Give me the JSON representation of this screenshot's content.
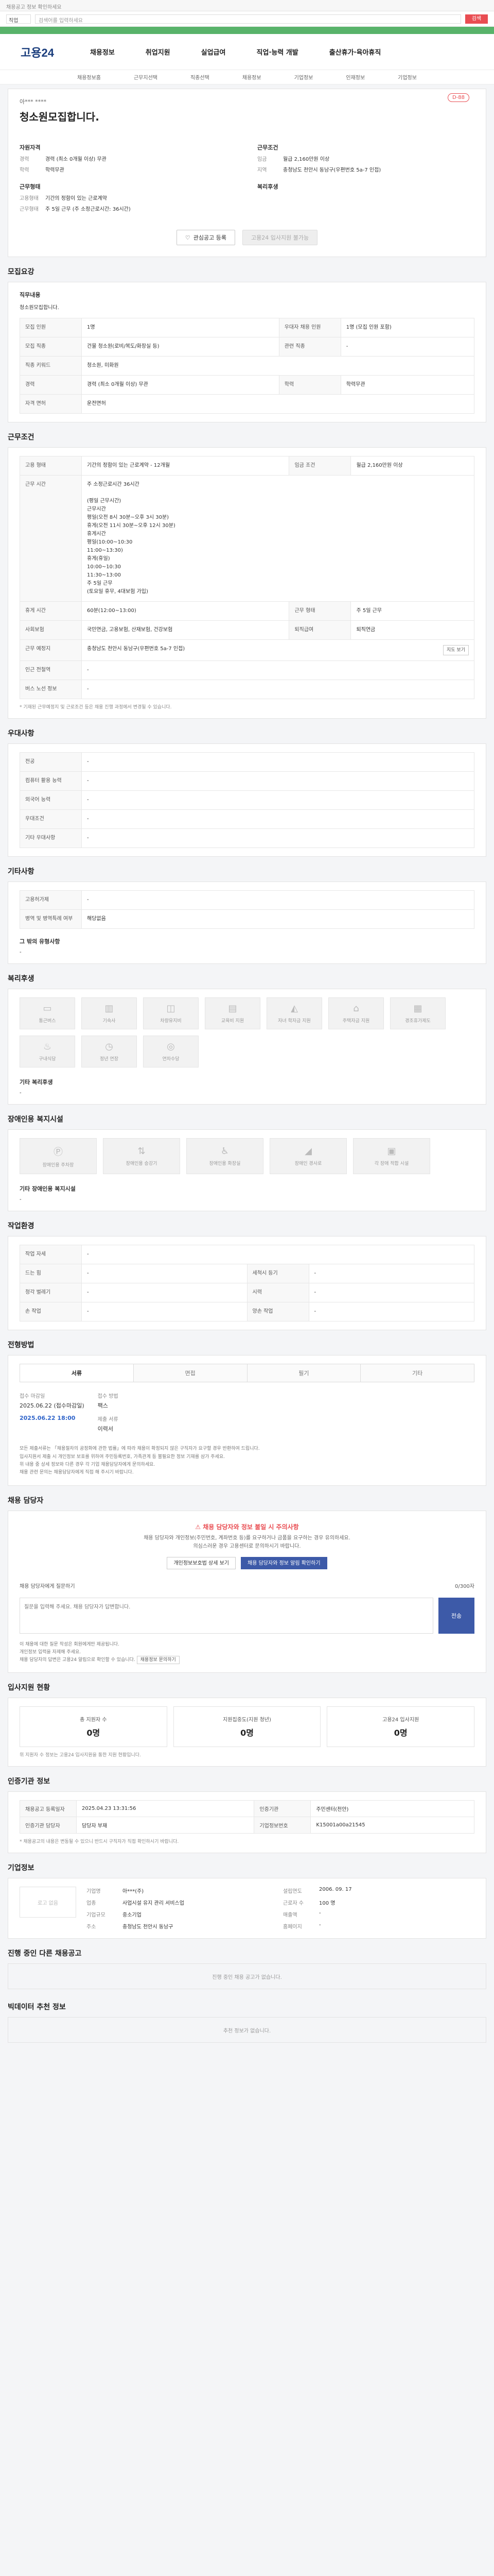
{
  "topnote": "채용공고 정보 확인하세요",
  "search": {
    "select": "직업",
    "placeholder": "검색어를 입력하세요",
    "button": "검색"
  },
  "greenbar": "",
  "header": {
    "logo": "고용24",
    "nav": [
      "채용정보",
      "취업지원",
      "실업급여",
      "직업·능력 개발",
      "출산휴가·육아휴직"
    ],
    "subnav": [
      "채용정보홈",
      "근무지선택",
      "직종선택",
      "채용정보",
      "기업정보",
      "인재정보",
      "기업정보"
    ]
  },
  "job": {
    "company": "아*** ****",
    "title": "청소원모집합니다.",
    "badge": "D-88",
    "left_title": "자원자격",
    "left_rows": [
      {
        "k": "경력",
        "v": "경력 (최소 0개월 이상) 무관"
      },
      {
        "k": "학력",
        "v": "학력무관"
      }
    ],
    "left_title2": "근무형태",
    "left_rows2": [
      {
        "k": "고용형태",
        "v": "기간의 정함이 있는 근로계약"
      },
      {
        "k": "근무형태",
        "v": "주 5일 근무 (주 소정근로시간: 36시간)"
      }
    ],
    "right_title": "근무조건",
    "right_rows": [
      {
        "k": "임금",
        "v": "월급 2,160만원 이상"
      },
      {
        "k": "지역",
        "v": "충청남도 천안시 동남구(우편번호 5a-7 인접)"
      }
    ],
    "right_title2": "복리후생",
    "btn_scrap": "관심공고 등록",
    "btn_apply": "고용24 입사지원 불가능"
  },
  "summary": {
    "title": "모집요강",
    "desc_label": "직무내용",
    "desc": "청소원모집합니다.",
    "rows": [
      [
        "모집 인원",
        "1명",
        "우대자 채용 인원",
        "1명 (모집 인원 포함)"
      ],
      [
        "모집 직종",
        "건물 청소원(로비/복도/화장실 등)",
        "관련 직종",
        "-"
      ],
      [
        "직종 키워드",
        "청소원, 미화원",
        "",
        ""
      ],
      [
        "경력",
        "경력 (최소 0개월 이상) 무관",
        "학력",
        "학력무관"
      ],
      [
        "자격 면허",
        "운전면허",
        "",
        ""
      ]
    ]
  },
  "conditions": {
    "title": "근무조건",
    "rows": [
      [
        "고용 형태",
        "기간의 정함이 있는 근로계약 - 12개월",
        "임금 조건",
        "월급 2,160만원 이상"
      ],
      [
        "근무 시간",
        "주 소정근로시간 36시간\n\n(평일 근무시간)\n근무시간\n평일(오전 8시 30분~오후 3시 30분)\n휴게(오전 11시 30분~오후 12시 30분)\n휴게시간\n평일(10:00~10:30\n       11:00~13:30)\n휴게(휴일)\n10:00~10:30\n11:30~13:00\n주 5일 근무\n(토요일 휴무, 4대보험 가입)",
        "",
        ""
      ],
      [
        "휴게 시간",
        "60분(12:00~13:00)",
        "근무 형태",
        "주 5일 근무"
      ],
      [
        "사회보험",
        "국민연금, 고용보험, 산재보험, 건강보험",
        "퇴직급여",
        "퇴직연금"
      ],
      [
        "근무 예정지",
        "충청남도 천안시 동남구(우편번호 5a-7 인접)",
        "",
        ""
      ],
      [
        "인근 전철역",
        "-",
        "",
        ""
      ],
      [
        "버스 노선 정보",
        "-",
        "",
        ""
      ]
    ],
    "mapbtn": "지도 보기",
    "note": "* 기재된 근무예정지 및 근로조건 등은 채용 진행 과정에서 변경될 수 있습니다."
  },
  "prefs": {
    "title": "우대사항",
    "rows": [
      [
        "전공",
        "-"
      ],
      [
        "컴퓨터 활용 능력",
        "-"
      ],
      [
        "외국어 능력",
        "-"
      ],
      [
        "우대조건",
        "-"
      ],
      [
        "기타 우대사항",
        "-"
      ]
    ]
  },
  "etc": {
    "title": "기타사항",
    "rows": [
      [
        "고용허가제",
        "-"
      ],
      [
        "병역 및 병역특례 여부",
        "해당없음"
      ]
    ],
    "extra_label": "그 밖의 유형사항",
    "extra_val": "-"
  },
  "welfare": {
    "title": "복리후생",
    "items": [
      "통근버스",
      "기숙사",
      "차량유지비",
      "교육비 지원",
      "자녀 학자금 지원",
      "주택자금 지원",
      "경조휴가제도",
      "구내식당",
      "정년 연장",
      "연차수당"
    ],
    "other_label": "기타 복리후생",
    "other_val": "-"
  },
  "disability": {
    "title": "장애인용 복지시설",
    "items": [
      "장애인용 주차장",
      "장애인용 승강기",
      "장애인용 화장실",
      "장애인 경사로",
      "각 장애 적합 시설"
    ],
    "other_label": "기타 장애인용 복지시설",
    "other_val": "-"
  },
  "pref_env": {
    "title": "작업환경",
    "rows": [
      [
        "작업 자세",
        "-",
        "",
        ""
      ],
      [
        "드는 힘",
        "-",
        "세척시 등기",
        "-"
      ],
      [
        "청각 벌레기",
        "-",
        "시력",
        "-"
      ],
      [
        "손 작업",
        "-",
        "양손 작업",
        "-"
      ]
    ]
  },
  "method": {
    "title": "전형방법",
    "tabs": [
      "서류",
      "면접",
      "필기",
      "기타"
    ],
    "deadline_label": "접수 마감일",
    "deadline": "2025.06.22 (접수마감일)",
    "deadline_time": "2025.06.22 18:00",
    "apply_label": "접수 방법",
    "apply": "팩스",
    "docs_label": "제출 서류",
    "docs": "이력서",
    "bullets": [
      "모든 제출서류는 「채용절차의 공정화에 관한 법률」에 따라 채용이 확정되지 않은 구직자가 요구할 경우 반환하여 드립니다.",
      "입사지원서 제출 시 개인정보 보호를 위하여 주민등록번호, 가족관계 등 불필요한 정보 기재를 삼가 주세요.",
      "위 내용 중 상세 정보와 다른 경우 각 기업 채용담당자에게 문의하세요.",
      "채용 관련 문의는 채용담당자에게 직접 해 주시기 바랍니다."
    ]
  },
  "contact": {
    "title": "채용 담당자",
    "warn_title": "채용 담당자와 정보 불일 시 주의사항",
    "warn_desc": "채용 담당자와 개인정보(주민번호, 계좌번호 등)를 요구하거나 금품을 요구하는 경우 유의하세요.\n의심스러운 경우 고용센터로 문의하시기 바랍니다.",
    "btn1": "개인정보보호법 상세 보기",
    "btn2": "채용 담당자와 정보 알림 확인하기",
    "ask_label": "채용 담당자에게 질문하기",
    "ask_note": "0/300자",
    "ask_placeholder": "질문을 입력해 주세요. 채용 담당자가 답변합니다.",
    "ask_btn": "전송",
    "notes": [
      "이 채용에 대한 질문 작성은 회원에게만 제공됩니다.",
      "개인정보 입력을 자제해 주세요.",
      "채용 담당자의 답변은 고용24 알림으로 확인할 수 있습니다."
    ],
    "notes_btn": "채용정보 문의하기"
  },
  "status": {
    "title": "입사지원 현황",
    "items": [
      {
        "l": "총 지원자 수",
        "n": "0명"
      },
      {
        "l": "지원집중도(지원 청년)",
        "n": "0명"
      },
      {
        "l": "고용24 입사지원",
        "n": "0명"
      }
    ],
    "note": "위 지원자 수 정보는 고용24 입사지원을 통한 지원 현황입니다."
  },
  "meta": {
    "title": "인증기관 정보",
    "rows": [
      [
        "채용공고 등록일자",
        "2025.04.23 13:31:56",
        "인증기관",
        "주민센터(천안)"
      ],
      [
        "인증기관 담당자",
        "담당자 부재",
        "기업정보번호",
        "K15001a00a21545"
      ]
    ],
    "note": "* 채용공고의 내용은 변동될 수 있으니 반드시 구직자가 직접 확인하시기 바랍니다."
  },
  "companyinfo": {
    "title": "기업정보",
    "logo": "로고 없음",
    "rows": [
      [
        "기업명",
        "아***(주)",
        "설립연도",
        "2006. 09. 17"
      ],
      [
        "업종",
        "사업시설 유지 관리 서비스업",
        "근로자 수",
        "100 명"
      ],
      [
        "기업규모",
        "중소기업",
        "매출액",
        "-"
      ],
      [
        "주소",
        "충청남도 천안시 동남구",
        "홈페이지",
        "-"
      ]
    ]
  },
  "similar": {
    "title": "진행 중인 다른 채용공고",
    "empty": "진행 중인 채용 공고가 없습니다."
  },
  "recommend": {
    "title": "빅데이터 추천 정보",
    "empty": "추천 정보가 없습니다."
  }
}
